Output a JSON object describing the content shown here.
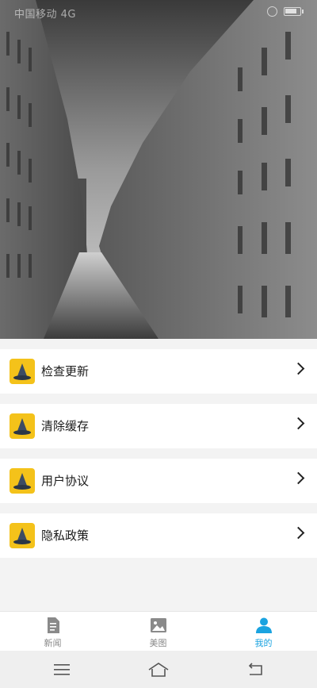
{
  "status_bar": {
    "left_text": "中国移动 4G"
  },
  "menu": {
    "items": [
      {
        "label": "检查更新",
        "icon": "app-logo-icon"
      },
      {
        "label": "清除缓存",
        "icon": "app-logo-icon"
      },
      {
        "label": "用户协议",
        "icon": "app-logo-icon"
      },
      {
        "label": "隐私政策",
        "icon": "app-logo-icon"
      }
    ]
  },
  "tabbar": {
    "tabs": [
      {
        "label": "新闻",
        "icon": "news-icon",
        "active": false
      },
      {
        "label": "美图",
        "icon": "image-icon",
        "active": false
      },
      {
        "label": "我的",
        "icon": "person-icon",
        "active": true
      }
    ]
  },
  "system_nav": {
    "buttons": [
      "menu-icon",
      "home-icon",
      "back-icon"
    ]
  },
  "colors": {
    "accent": "#1aa3e0",
    "icon_bg": "#f4c21a",
    "background": "#f3f3f3"
  }
}
